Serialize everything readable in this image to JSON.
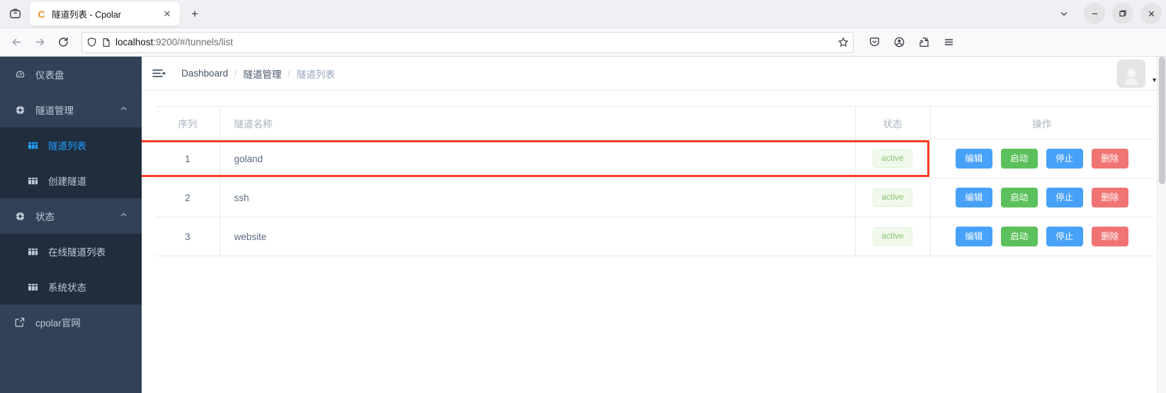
{
  "browser": {
    "tab": {
      "favicon_letter": "C",
      "title": "隧道列表 - Cpolar",
      "close_label": "✕"
    },
    "new_tab_label": "+",
    "list_all_tabs_icon": "chevron-down-icon",
    "window_controls": {
      "minimize": "—",
      "maximize": "❐",
      "close": "✕"
    },
    "nav": {
      "back": "←",
      "forward": "→",
      "reload": "⟳",
      "url_host": "localhost",
      "url_rest": ":9200/#/tunnels/list",
      "bookmark_star": "☆"
    },
    "toolbar_right": [
      "save-to-pocket-icon",
      "account-icon",
      "extensions-icon",
      "app-menu-icon"
    ]
  },
  "sidebar": {
    "items": [
      {
        "label": "仪表盘",
        "icon": "dashboard-icon",
        "type": "item",
        "name": "sidebar-item-dashboard"
      },
      {
        "label": "隧道管理",
        "icon": "tunnel-icon",
        "type": "group",
        "arrow": "⌃",
        "name": "sidebar-group-tunnel-management"
      },
      {
        "label": "隧道列表",
        "icon": "grid-icon",
        "type": "sub",
        "active": true,
        "name": "sidebar-item-tunnel-list"
      },
      {
        "label": "创建隧道",
        "icon": "grid-icon",
        "type": "sub",
        "active": false,
        "name": "sidebar-item-create-tunnel"
      },
      {
        "label": "状态",
        "icon": "status-icon",
        "type": "group",
        "arrow": "⌃",
        "name": "sidebar-group-status"
      },
      {
        "label": "在线隧道列表",
        "icon": "grid-icon",
        "type": "sub",
        "active": false,
        "name": "sidebar-item-online-tunnel-list"
      },
      {
        "label": "系统状态",
        "icon": "grid-icon",
        "type": "sub",
        "active": false,
        "name": "sidebar-item-system-status"
      },
      {
        "label": "cpolar官网",
        "icon": "external-link-icon",
        "type": "item",
        "name": "sidebar-item-cpolar-website"
      }
    ]
  },
  "topbar": {
    "menu_toggle_icon": "hamburger-icon",
    "breadcrumb": [
      {
        "label": "Dashboard",
        "current": false
      },
      {
        "label": "隧道管理",
        "current": false
      },
      {
        "label": "隧道列表",
        "current": true
      }
    ],
    "separator": "/",
    "avatar_icon": "user-avatar",
    "caret_icon": "caret-down-icon"
  },
  "table": {
    "columns": [
      "序列",
      "隧道名称",
      "状态",
      "操作"
    ],
    "rows": [
      {
        "index": "1",
        "name": "goland",
        "status": "active",
        "actions": [
          "编辑",
          "启动",
          "停止",
          "删除"
        ],
        "highlighted": true
      },
      {
        "index": "2",
        "name": "ssh",
        "status": "active",
        "actions": [
          "编辑",
          "启动",
          "停止",
          "删除"
        ],
        "highlighted": false
      },
      {
        "index": "3",
        "name": "website",
        "status": "active",
        "actions": [
          "编辑",
          "启动",
          "停止",
          "删除"
        ],
        "highlighted": false
      }
    ]
  },
  "colors": {
    "sidebar_bg": "#324157",
    "submenu_bg": "#1f2d3d",
    "accent": "#20a0ff",
    "btn_primary": "#48a1f8",
    "btn_success": "#5cc15c",
    "btn_danger": "#f07474",
    "badge_text": "#8cc372",
    "badge_bg": "#f0f9eb",
    "highlight_border": "#fb3b21"
  }
}
